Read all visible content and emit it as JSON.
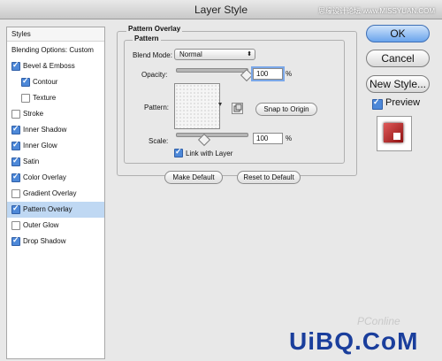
{
  "window": {
    "title": "Layer Style",
    "watermark_top": "思缘设计论坛 www.MISSYUAN.COM"
  },
  "styles": {
    "header": "Styles",
    "items": [
      {
        "label": "Blending Options: Custom",
        "checkbox": false,
        "checked": false,
        "indent": false,
        "selected": false
      },
      {
        "label": "Bevel & Emboss",
        "checkbox": true,
        "checked": true,
        "indent": false,
        "selected": false
      },
      {
        "label": "Contour",
        "checkbox": true,
        "checked": true,
        "indent": true,
        "selected": false
      },
      {
        "label": "Texture",
        "checkbox": true,
        "checked": false,
        "indent": true,
        "selected": false
      },
      {
        "label": "Stroke",
        "checkbox": true,
        "checked": false,
        "indent": false,
        "selected": false
      },
      {
        "label": "Inner Shadow",
        "checkbox": true,
        "checked": true,
        "indent": false,
        "selected": false
      },
      {
        "label": "Inner Glow",
        "checkbox": true,
        "checked": true,
        "indent": false,
        "selected": false
      },
      {
        "label": "Satin",
        "checkbox": true,
        "checked": true,
        "indent": false,
        "selected": false
      },
      {
        "label": "Color Overlay",
        "checkbox": true,
        "checked": true,
        "indent": false,
        "selected": false
      },
      {
        "label": "Gradient Overlay",
        "checkbox": true,
        "checked": false,
        "indent": false,
        "selected": false
      },
      {
        "label": "Pattern Overlay",
        "checkbox": true,
        "checked": true,
        "indent": false,
        "selected": true
      },
      {
        "label": "Outer Glow",
        "checkbox": true,
        "checked": false,
        "indent": false,
        "selected": false
      },
      {
        "label": "Drop Shadow",
        "checkbox": true,
        "checked": true,
        "indent": false,
        "selected": false
      }
    ]
  },
  "pattern_overlay": {
    "group_title": "Pattern Overlay",
    "sub_title": "Pattern",
    "blend_mode_label": "Blend Mode:",
    "blend_mode_value": "Normal",
    "opacity_label": "Opacity:",
    "opacity_value": "100",
    "opacity_unit": "%",
    "opacity_fraction": 1.0,
    "pattern_label": "Pattern:",
    "snap_button": "Snap to Origin",
    "scale_label": "Scale:",
    "scale_value": "100",
    "scale_unit": "%",
    "scale_fraction": 0.4,
    "link_label": "Link with Layer",
    "link_checked": true,
    "make_default": "Make Default",
    "reset_default": "Reset to Default"
  },
  "buttons": {
    "ok": "OK",
    "cancel": "Cancel",
    "new_style": "New Style...",
    "preview_label": "Preview",
    "preview_checked": true
  },
  "watermarks": {
    "pconline": "PConline",
    "uibq": "UiBQ.CoM"
  },
  "colors": {
    "accent": "#4d88d8",
    "selection": "#bfd8f3",
    "ok_button": "#6aa4ec",
    "preview_red": "#b01818"
  }
}
